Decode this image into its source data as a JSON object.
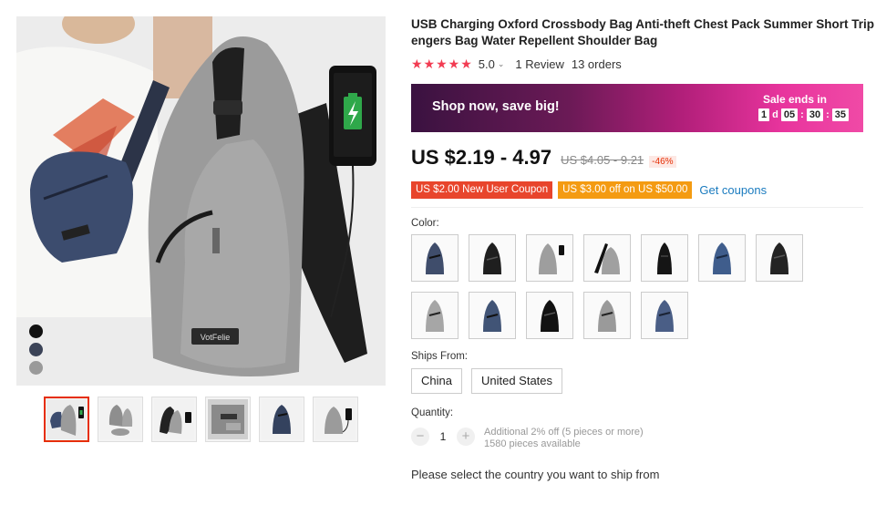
{
  "product": {
    "title_line1": "USB Charging Oxford Crossbody Bag Anti-theft Chest Pack Summer Short Trip Mess",
    "title_line2": "engers Bag Water Repellent Shoulder Bag",
    "image_text": "VotFelie"
  },
  "rating": {
    "stars": "★★★★★",
    "score": "5.0",
    "chevron": "⌄",
    "reviews": "1 Review",
    "orders": "13 orders"
  },
  "banner": {
    "promo": "Shop now, save big!",
    "sale_title": "Sale ends in",
    "days": "1",
    "days_unit": "d",
    "hours": "05",
    "minutes": "30",
    "seconds": "35",
    "sep": ":"
  },
  "price": {
    "current": "US $2.19 - 4.97",
    "original": "US $4.05 - 9.21",
    "discount": "-46%"
  },
  "coupons": {
    "new_user": "US $2.00 New User Coupon",
    "off": "US $3.00 off on US $50.00",
    "link": "Get coupons"
  },
  "color": {
    "label": "Color:",
    "options": [
      "navy",
      "black",
      "gray-usb",
      "gray-detail",
      "black-slim",
      "blue",
      "black-2",
      "gray-2",
      "blue-2",
      "black-3",
      "gray-3",
      "navy-2"
    ]
  },
  "ships_from": {
    "label": "Ships From:",
    "options": [
      "China",
      "United States"
    ]
  },
  "quantity": {
    "label": "Quantity:",
    "minus": "−",
    "value": "1",
    "plus": "+",
    "discount_note": "Additional 2% off (5 pieces or more)",
    "available": "1580 pieces available"
  },
  "ship_note": "Please select the country you want to ship from",
  "colors": {
    "accent": "#e62e04",
    "star": "#f23c52",
    "link": "#1a7bbf",
    "coupon_red": "#e8452c",
    "coupon_orange": "#f49b12"
  },
  "swatch_colors": [
    "#111111",
    "#3b4357",
    "#9a9a9a"
  ]
}
